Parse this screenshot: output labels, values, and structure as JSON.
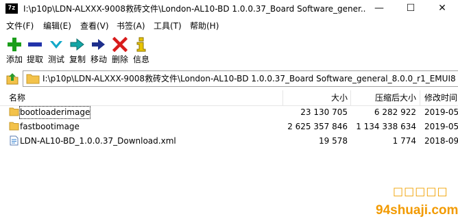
{
  "window": {
    "app_icon_text": "7z",
    "title": "I:\\p10p\\LDN-ALXXX-9008救砖文件\\London-AL10-BD 1.0.0.37_Board Software_gener...",
    "minimize": "—",
    "maximize": "☐",
    "close": "✕"
  },
  "menu": [
    "文件(F)",
    "编辑(E)",
    "查看(V)",
    "书签(A)",
    "工具(T)",
    "帮助(H)"
  ],
  "toolbar": {
    "add": "添加",
    "extract": "提取",
    "test": "测试",
    "copy": "复制",
    "move": "移动",
    "delete": "删除",
    "info": "信息"
  },
  "address": {
    "path": "I:\\p10p\\LDN-ALXXX-9008救砖文件\\London-AL10-BD 1.0.0.37_Board Software_general_8.0.0_r1_EMUI8"
  },
  "columns": {
    "name": "名称",
    "size": "大小",
    "packed": "压缩后大小",
    "modified": "修改时间"
  },
  "files": [
    {
      "name": "bootloaderimage",
      "size": "23 130 705",
      "packed": "6 282 922",
      "modified": "2019-05",
      "icon": "folder-icon"
    },
    {
      "name": "fastbootimage",
      "size": "2 625 357 846",
      "packed": "1 134 338 634",
      "modified": "2019-05",
      "icon": "folder-icon"
    },
    {
      "name": "LDN-AL10-BD_1.0.0.37_Download.xml",
      "size": "19 578",
      "packed": "1 774",
      "modified": "2018-09",
      "icon": "xml-file-icon"
    }
  ],
  "watermark": {
    "top": "□□□□□",
    "bottom": "94shuaji.com"
  },
  "colors": {
    "add": "#1a9e1a",
    "extract": "#2233aa",
    "test": "#12a8c8",
    "delete": "#d81b1b",
    "info": "#e8c400",
    "folder": "#f3c24a",
    "watermark": "#f29a00"
  }
}
